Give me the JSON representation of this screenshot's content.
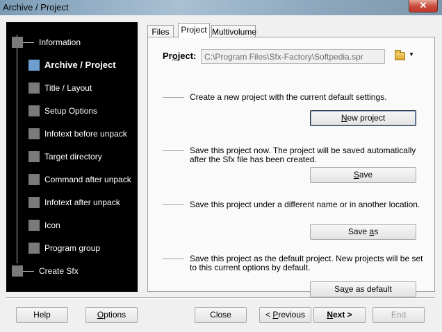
{
  "window": {
    "title": "Archive / Project",
    "close_glyph": "✕"
  },
  "nav": {
    "items": [
      {
        "label": "Information"
      },
      {
        "label": "Archive / Project"
      },
      {
        "label": "Title / Layout"
      },
      {
        "label": "Setup Options"
      },
      {
        "label": "Infotext before unpack"
      },
      {
        "label": "Target directory"
      },
      {
        "label": "Command after unpack"
      },
      {
        "label": "Infotext after unpack"
      },
      {
        "label": "Icon"
      },
      {
        "label": "Program group"
      },
      {
        "label": "Create Sfx"
      }
    ],
    "active_index": 1
  },
  "tabs": [
    {
      "label": "Files"
    },
    {
      "label": "Project"
    },
    {
      "label": "Multivolume"
    }
  ],
  "project": {
    "label_pre": "Pr",
    "label_u": "o",
    "label_post": "ject:",
    "value": "C:\\Program Files\\Sfx-Factory\\Softpedia.spr",
    "folder_icon": "folder-open-icon",
    "chevron": "▼"
  },
  "sections": [
    {
      "text": "Create a new project with the current default settings.",
      "button_pre": "",
      "button_u": "N",
      "button_post": "ew project"
    },
    {
      "text": "Save this project now. The project will be saved automatically after the Sfx file has been created.",
      "button_pre": "",
      "button_u": "S",
      "button_post": "ave"
    },
    {
      "text": "Save this project under a different name or in another location.",
      "button_pre": "Save ",
      "button_u": "a",
      "button_post": "s"
    },
    {
      "text": "Save this project as the default project. New projects will be set to this current options by default.",
      "button_pre": "Sa",
      "button_u": "v",
      "button_post": "e as default"
    }
  ],
  "footer": {
    "help": "Help",
    "options_u": "O",
    "options_post": "ptions",
    "close": "Close",
    "previous_pre": "< ",
    "previous_u": "P",
    "previous_post": "revious",
    "next": "Next >",
    "next_u": "N",
    "next_post": "ext >",
    "end": "End"
  }
}
